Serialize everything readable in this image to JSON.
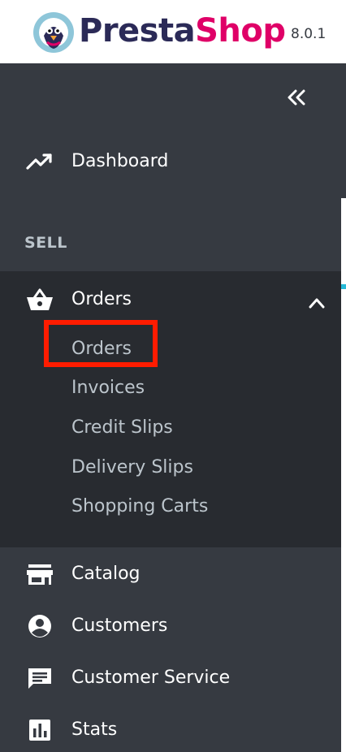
{
  "header": {
    "brand_part1": "Presta",
    "brand_part2": "Shop",
    "version": "8.0.1"
  },
  "sidebar": {
    "collapse_label": "<<",
    "dashboard_label": "Dashboard",
    "section_sell": "SELL",
    "orders": {
      "label": "Orders",
      "expanded": true,
      "submenu": [
        "Orders",
        "Invoices",
        "Credit Slips",
        "Delivery Slips",
        "Shopping Carts"
      ]
    },
    "items": [
      {
        "label": "Catalog",
        "icon": "store-icon"
      },
      {
        "label": "Customers",
        "icon": "account-circle-icon"
      },
      {
        "label": "Customer Service",
        "icon": "chat-icon"
      },
      {
        "label": "Stats",
        "icon": "bar-chart-icon"
      }
    ]
  },
  "colors": {
    "sidebar_bg": "#363a41",
    "submenu_bg": "#282b30",
    "highlight": "#ff1c00",
    "brand_dark": "#2b2a57",
    "brand_pink": "#df0067",
    "accent": "#25b9d7"
  }
}
